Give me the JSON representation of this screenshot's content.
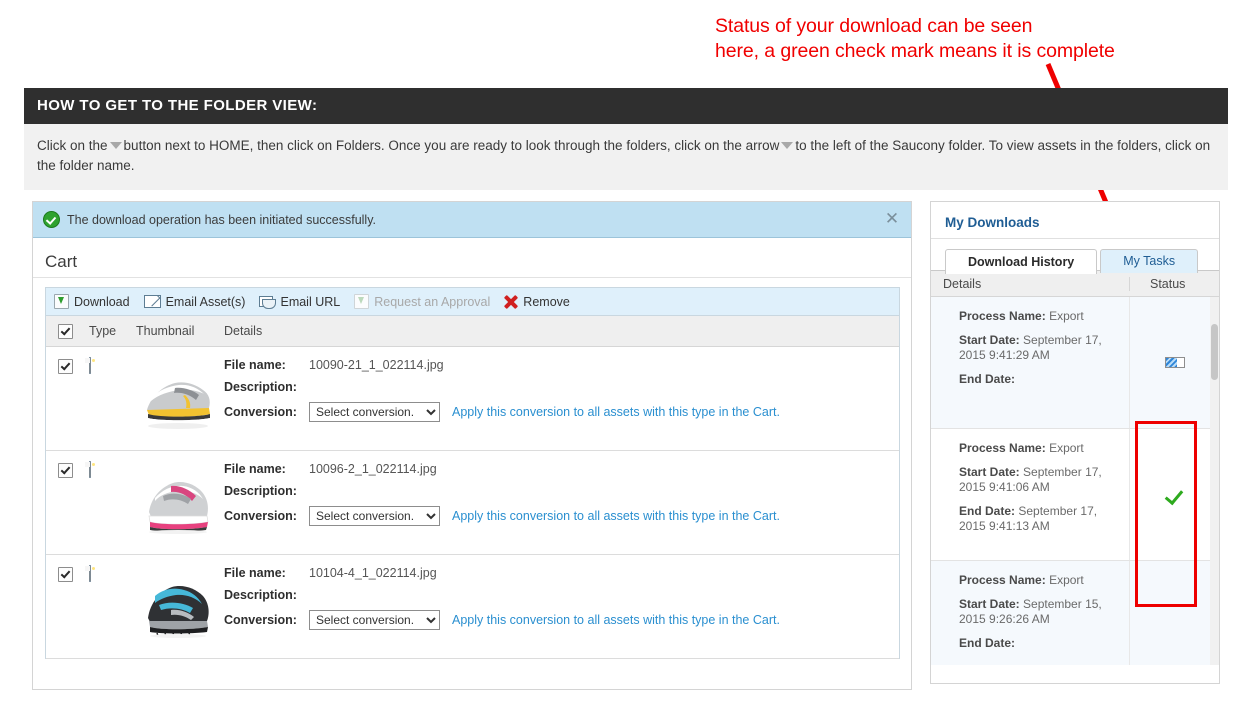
{
  "annotation": {
    "text": "Status of your download can be seen\nhere, a green check mark means it is complete",
    "color": "#f00000",
    "arrow_color": "#ee0000"
  },
  "banner": {
    "heading": "HOW TO GET TO THE FOLDER VIEW:",
    "body_part1": "Click on the",
    "body_part2": "button next to HOME, then click on Folders. Once you are ready to look through the folders, click on the arrow",
    "body_part3": "to the left of the Saucony folder. To view assets in the folders, click on the folder name.",
    "caret_icon": "caret-down-icon"
  },
  "cart": {
    "alert": {
      "icon": "success-check-icon",
      "message": "The download operation has been initiated successfully.",
      "close_icon": "close-icon",
      "close_label": "✕"
    },
    "title": "Cart",
    "toolbar": [
      {
        "label": "Download",
        "icon": "download-icon",
        "disabled": false
      },
      {
        "label": "Email Asset(s)",
        "icon": "envelope-icon",
        "disabled": false
      },
      {
        "label": "Email URL",
        "icon": "envelope-url-icon",
        "disabled": false
      },
      {
        "label": "Request an Approval",
        "icon": "download-icon-disabled",
        "disabled": true
      },
      {
        "label": "Remove",
        "icon": "red-x-icon",
        "disabled": false
      }
    ],
    "columns": {
      "select_all_icon": "checkbox-checked-icon",
      "type": "Type",
      "thumbnail": "Thumbnail",
      "details": "Details"
    },
    "labels": {
      "file_name": "File name:",
      "description": "Description:",
      "conversion": "Conversion:",
      "apply_link": "Apply this conversion to all assets with this type in the Cart.",
      "conversion_value": "Select conversion.",
      "conversion_options": [
        "Select conversion."
      ]
    },
    "rows": [
      {
        "checked": true,
        "type_icon": "image-file-icon",
        "thumbnail": "grey-yellow-running-shoe",
        "file_name": "10090-21_1_022114.jpg",
        "description": "",
        "conversion": "Select conversion."
      },
      {
        "checked": true,
        "type_icon": "image-file-icon",
        "thumbnail": "grey-pink-running-shoe",
        "file_name": "10096-2_1_022114.jpg",
        "description": "",
        "conversion": "Select conversion."
      },
      {
        "checked": true,
        "type_icon": "image-file-icon",
        "thumbnail": "black-teal-running-shoe",
        "file_name": "10104-4_1_022114.jpg",
        "description": "",
        "conversion": "Select conversion."
      }
    ]
  },
  "sidebar": {
    "title": "My Downloads",
    "tabs": [
      {
        "label": "Download History",
        "active": true
      },
      {
        "label": "My Tasks",
        "active": false
      }
    ],
    "columns": {
      "details": "Details",
      "status": "Status"
    },
    "labels": {
      "process_name": "Process Name:",
      "start_date": "Start Date:",
      "end_date": "End Date:"
    },
    "history": [
      {
        "process_name": "Export",
        "start_date": "September 17, 2015 9:41:29 AM",
        "end_date": "",
        "status_icon": "in-progress-icon"
      },
      {
        "process_name": "Export",
        "start_date": "September 17, 2015 9:41:06 AM",
        "end_date": "September 17, 2015 9:41:13 AM",
        "status_icon": "green-check-icon"
      },
      {
        "process_name": "Export",
        "start_date": "September 15, 2015 9:26:26 AM",
        "end_date": "",
        "status_icon": ""
      }
    ]
  }
}
